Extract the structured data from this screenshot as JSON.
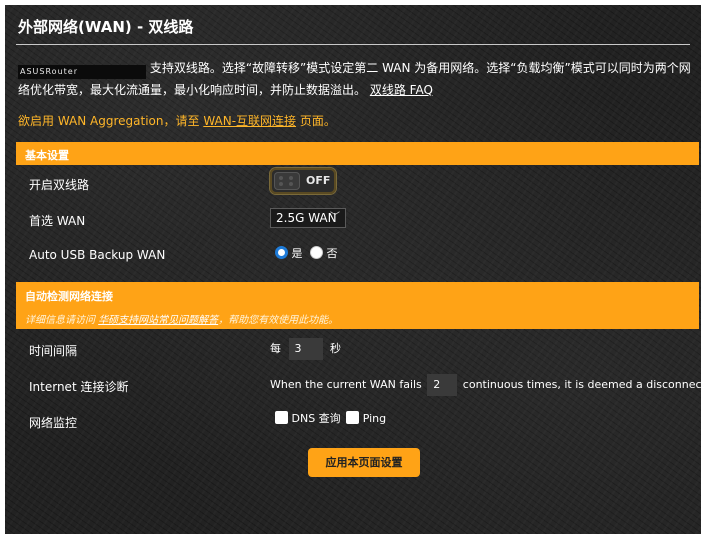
{
  "page": {
    "title": "外部网络(WAN) - 双线路",
    "router_name": "ASUSRouter",
    "description_part1": "支持双线路。选择“故障转移”模式设定第二 WAN 为备用网络。选择“负载均衡”模式可以同时为两个网络优化带宽，最大化流通量，最小化响应时间，并防止数据溢出。",
    "faq_link": "双线路 FAQ",
    "notice_text": "欲启用 WAN Aggregation，请至",
    "notice_link": "WAN-互联网连接",
    "notice_suffix": "页面。"
  },
  "basic": {
    "section_title": "基本设置",
    "enable_label": "开启双线路",
    "toggle_state": "OFF",
    "primary_wan_label": "首选 WAN",
    "primary_wan_value": "2.5G WAN",
    "usb_backup_label": "Auto USB Backup WAN",
    "radio_yes": "是",
    "radio_no": "否",
    "usb_backup_selected": "是"
  },
  "detect": {
    "section_title": "自动检测网络连接",
    "sub_prefix": "详细信息请访问",
    "sub_link": "华硕支持网站常见问题解答",
    "sub_suffix": "，帮助您有效使用此功能。",
    "interval_label": "时间间隔",
    "interval_prefix": "每",
    "interval_value": "3",
    "interval_unit": "秒",
    "diag_label": "Internet 连接诊断",
    "diag_prefix": "When the current WAN fails",
    "diag_value": "2",
    "diag_suffix": "continuous times, it is deemed a disconnection.",
    "monitor_label": "网络监控",
    "dns_label": "DNS 查询",
    "ping_label": "Ping",
    "dns_checked": false,
    "ping_checked": false
  },
  "actions": {
    "apply_label": "应用本页面设置"
  },
  "colors": {
    "accent": "#ffa316",
    "background": "#222222",
    "notice": "#ffb629",
    "radio_selected": "#1e7bd8"
  }
}
